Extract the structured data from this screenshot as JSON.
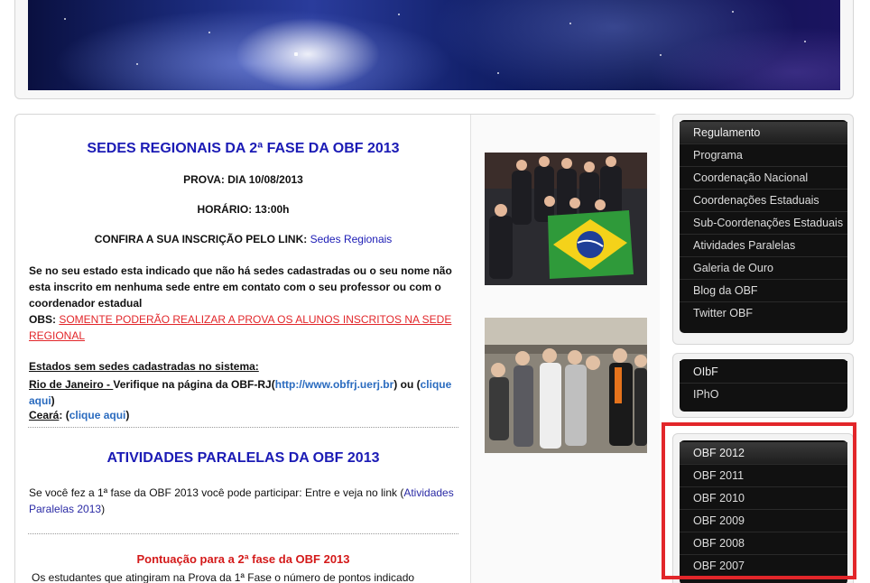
{
  "main": {
    "section1_title": "SEDES REGIONAIS DA 2ª FASE DA OBF 2013",
    "prova": "PROVA: DIA 10/08/2013",
    "horario": "HORÁRIO: 13:00h",
    "confira_prefix": "CONFIRA A SUA INSCRIÇÃO PELO LINK: ",
    "confira_link": "Sedes Regionais",
    "aviso": "Se no seu estado esta indicado que não há sedes cadastradas ou o seu nome não esta inscrito em nenhuma sede entre em contato com o seu professor ou com o coordenador estadual",
    "obs_prefix": "OBS: ",
    "obs_text": "SOMENTE PODERÃO REALIZAR A PROVA OS ALUNOS INSCRITOS NA SEDE REGIONAL",
    "estados_heading": "Estados sem sedes cadastradas no sistema:",
    "rj_label": "Rio de Janeiro - ",
    "rj_text": "Verifique na página da OBF-RJ(",
    "rj_url": "http://www.obfrj.uerj.br",
    "rj_text2": ") ou (",
    "rj_click": "clique aqui",
    "rj_close": ")",
    "ce_label": "Ceará",
    "ce_text": ": (",
    "ce_click": "clique aqui",
    "ce_close": ")",
    "section2_title": "ATIVIDADES PARALELAS DA OBF 2013",
    "ativ_text": "Se você fez a 1ª fase da OBF 2013 você pode participar: Entre e veja no link (",
    "ativ_link": "Atividades Paralelas 2013",
    "ativ_close": ")",
    "section3_title": "Pontuação para a 2ª fase da OBF 2013",
    "section3_text": "Os estudantes que atingiram  na Prova da 1ª Fase  o número de pontos indicado"
  },
  "sidebar": {
    "menu1": [
      "Regulamento",
      "Programa",
      "Coordenação Nacional",
      "Coordenações Estaduais",
      "Sub-Coordenações Estaduais",
      "Atividades Paralelas",
      "Galeria de Ouro",
      "Blog da OBF",
      "Twitter OBF"
    ],
    "menu2": [
      "OIbF",
      "IPhO"
    ],
    "menu3": [
      "OBF 2012",
      "OBF 2011",
      "OBF 2010",
      "OBF 2009",
      "OBF 2008",
      "OBF 2007"
    ]
  },
  "colors": {
    "heading_blue": "#1b1bb5",
    "alert_red": "#e2262a",
    "menu_bg": "#111111"
  },
  "icons": {
    "photo1": "group-photo-brazil-flag",
    "photo2": "group-photo-students"
  }
}
